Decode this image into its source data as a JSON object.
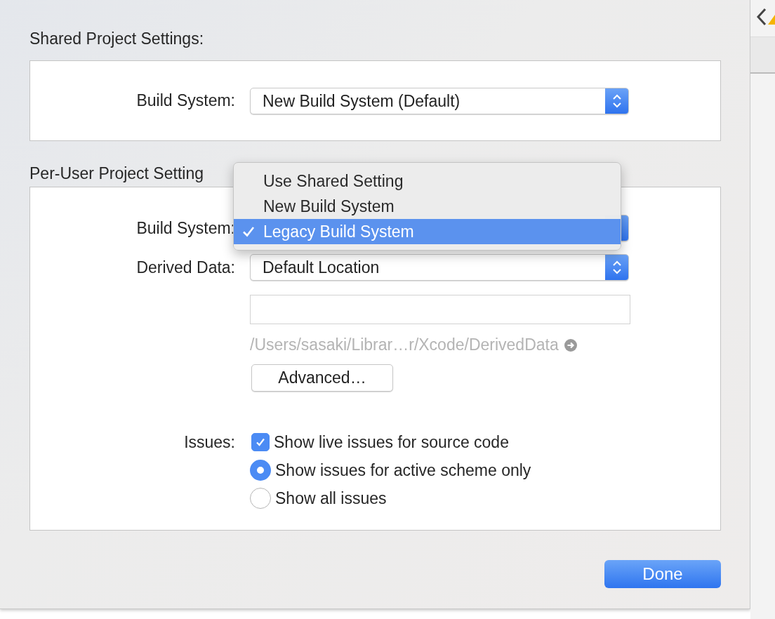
{
  "shared": {
    "title": "Shared Project Settings:",
    "build_system": {
      "label": "Build System:",
      "value": "New Build System (Default)"
    }
  },
  "per_user": {
    "title": "Per-User Project Setting",
    "build_system": {
      "label": "Build System:",
      "menu": [
        {
          "label": "Use Shared Setting",
          "selected": false
        },
        {
          "label": "New Build System",
          "selected": false
        },
        {
          "label": "Legacy Build System",
          "selected": true
        }
      ]
    },
    "derived_data": {
      "label": "Derived Data:",
      "value": "Default Location"
    },
    "path": "/Users/sasaki/Librar…r/Xcode/DerivedData",
    "advanced_button": "Advanced…",
    "issues": {
      "label": "Issues:",
      "options": [
        {
          "kind": "checkbox",
          "label": "Show live issues for source code",
          "checked": true
        },
        {
          "kind": "radio",
          "label": "Show issues for active scheme only",
          "selected": true
        },
        {
          "kind": "radio",
          "label": "Show all issues",
          "selected": false
        }
      ]
    }
  },
  "done_button": "Done"
}
